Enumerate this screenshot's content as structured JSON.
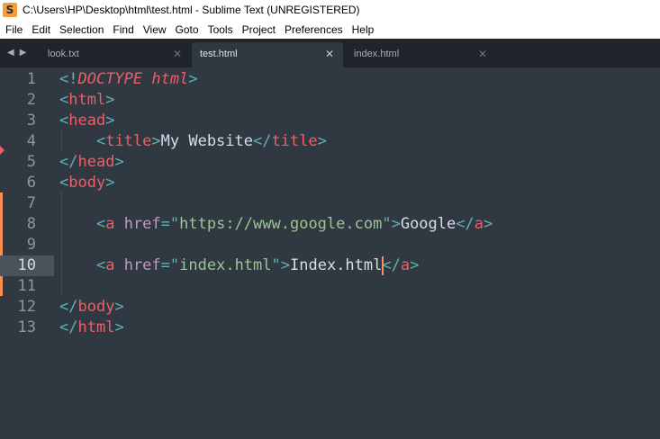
{
  "window": {
    "title": "C:\\Users\\HP\\Desktop\\html\\test.html - Sublime Text (UNREGISTERED)",
    "app_icon": "S"
  },
  "menu": [
    "File",
    "Edit",
    "Selection",
    "Find",
    "View",
    "Goto",
    "Tools",
    "Project",
    "Preferences",
    "Help"
  ],
  "tabs": [
    {
      "label": "look.txt",
      "active": false
    },
    {
      "label": "test.html",
      "active": true
    },
    {
      "label": "index.html",
      "active": false
    }
  ],
  "editor": {
    "current_line": 10,
    "lines": [
      {
        "n": "1",
        "tokens": [
          [
            "p",
            "<!"
          ],
          [
            "d",
            "DOCTYPE"
          ],
          [
            "p",
            " "
          ],
          [
            "d",
            "html"
          ],
          [
            "p",
            ">"
          ]
        ]
      },
      {
        "n": "2",
        "tokens": [
          [
            "p",
            "<"
          ],
          [
            "t",
            "html"
          ],
          [
            "p",
            ">"
          ]
        ]
      },
      {
        "n": "3",
        "tokens": [
          [
            "p",
            "<"
          ],
          [
            "t",
            "head"
          ],
          [
            "p",
            ">"
          ]
        ]
      },
      {
        "n": "4",
        "tokens": [
          [
            "x",
            "    "
          ],
          [
            "p",
            "<"
          ],
          [
            "t",
            "title"
          ],
          [
            "p",
            ">"
          ],
          [
            "x",
            "My Website"
          ],
          [
            "p",
            "</"
          ],
          [
            "t",
            "title"
          ],
          [
            "p",
            ">"
          ]
        ]
      },
      {
        "n": "5",
        "tokens": [
          [
            "p",
            "</"
          ],
          [
            "t",
            "head"
          ],
          [
            "p",
            ">"
          ]
        ]
      },
      {
        "n": "6",
        "tokens": [
          [
            "p",
            "<"
          ],
          [
            "t",
            "body"
          ],
          [
            "p",
            ">"
          ]
        ]
      },
      {
        "n": "7",
        "tokens": []
      },
      {
        "n": "8",
        "tokens": [
          [
            "x",
            "    "
          ],
          [
            "p",
            "<"
          ],
          [
            "t",
            "a"
          ],
          [
            "x",
            " "
          ],
          [
            "a",
            "href"
          ],
          [
            "p",
            "="
          ],
          [
            "p",
            "\""
          ],
          [
            "s",
            "https://www.google.com"
          ],
          [
            "p",
            "\""
          ],
          [
            "p",
            ">"
          ],
          [
            "x",
            "Google"
          ],
          [
            "p",
            "</"
          ],
          [
            "t",
            "a"
          ],
          [
            "p",
            ">"
          ]
        ]
      },
      {
        "n": "9",
        "tokens": []
      },
      {
        "n": "10",
        "tokens": [
          [
            "x",
            "    "
          ],
          [
            "p",
            "<"
          ],
          [
            "t",
            "a"
          ],
          [
            "x",
            " "
          ],
          [
            "a",
            "href"
          ],
          [
            "p",
            "="
          ],
          [
            "p",
            "\""
          ],
          [
            "s",
            "index.html"
          ],
          [
            "p",
            "\""
          ],
          [
            "p",
            ">"
          ],
          [
            "x",
            "Index.html"
          ],
          [
            "p",
            "</"
          ],
          [
            "t",
            "a"
          ],
          [
            "p",
            ">"
          ]
        ]
      },
      {
        "n": "11",
        "tokens": []
      },
      {
        "n": "12",
        "tokens": [
          [
            "p",
            "</"
          ],
          [
            "t",
            "body"
          ],
          [
            "p",
            ">"
          ]
        ]
      },
      {
        "n": "13",
        "tokens": [
          [
            "p",
            "</"
          ],
          [
            "t",
            "html"
          ],
          [
            "p",
            ">"
          ]
        ]
      }
    ]
  },
  "colors": {
    "background": "#303841",
    "tabbar": "#1f252b",
    "tag": "#ec5f67",
    "punctuation": "#5fb3b3",
    "attribute": "#c594c5",
    "string": "#99c794",
    "modified": "#f99157"
  }
}
